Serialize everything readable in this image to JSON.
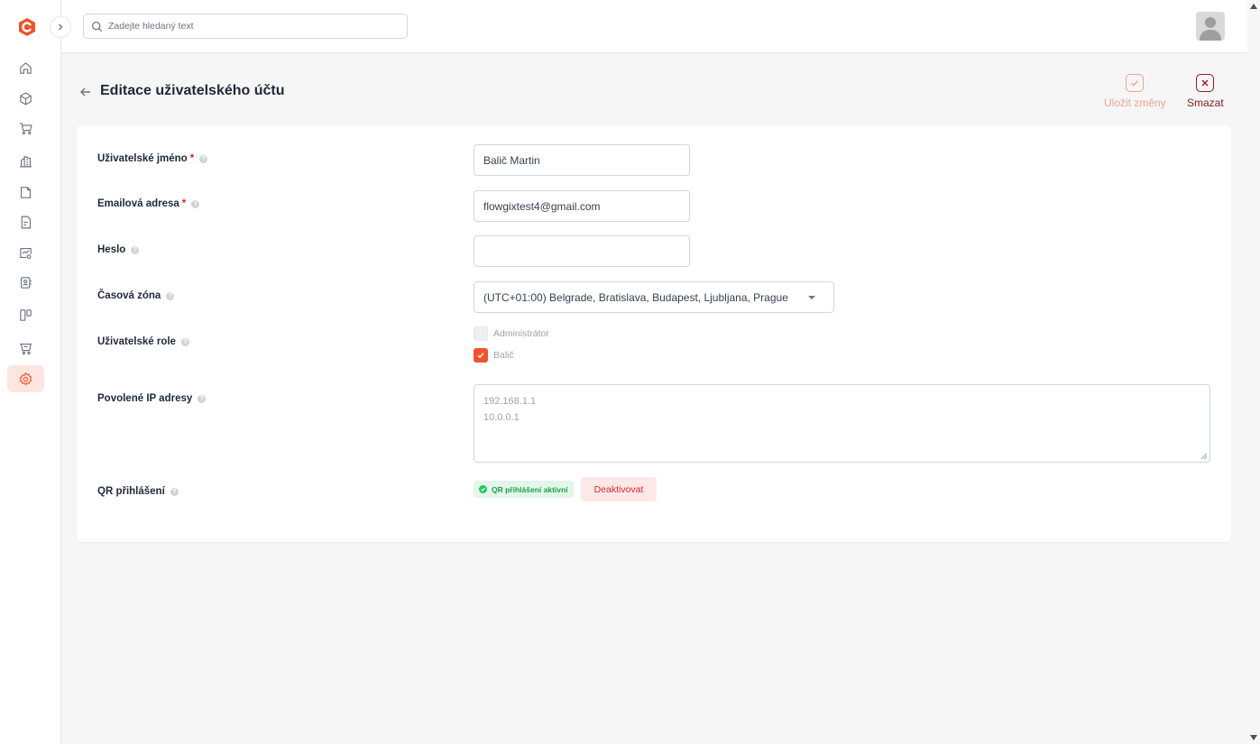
{
  "search": {
    "placeholder": "Zadejte hledaný text"
  },
  "page": {
    "title": "Editace uživatelského účtu",
    "save_label": "Uložit změny",
    "delete_label": "Smazat"
  },
  "form": {
    "username": {
      "label": "Uživatelské jméno",
      "value": "Balič Martin",
      "required": "*"
    },
    "email": {
      "label": "Emailová adresa",
      "value": "flowgixtest4@gmail.com",
      "required": "*"
    },
    "password": {
      "label": "Heslo",
      "value": ""
    },
    "timezone": {
      "label": "Časová zóna",
      "value": "(UTC+01:00) Belgrade, Bratislava, Budapest, Ljubljana, Prague"
    },
    "roles": {
      "label": "Uživatelské role",
      "options": [
        {
          "label": "Administrátor",
          "checked": false
        },
        {
          "label": "Balič",
          "checked": true
        }
      ]
    },
    "ips": {
      "label": "Povolené IP adresy",
      "lines": [
        "192.168.1.1",
        "10.0.0.1"
      ]
    },
    "qr": {
      "label": "QR přihlášení",
      "status": "QR přihlášení aktivní",
      "action": "Deaktivovat"
    }
  },
  "help_glyph": "?",
  "colors": {
    "accent": "#f0532b",
    "active_nav_bg": "#fde6df",
    "danger": "#dc2626",
    "success": "#16a34a"
  }
}
